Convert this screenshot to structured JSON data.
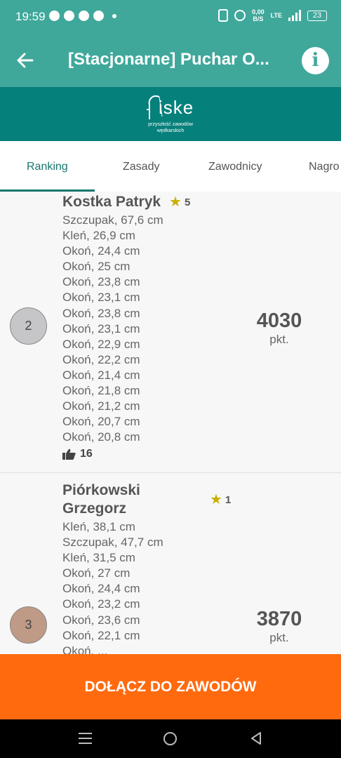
{
  "status_bar": {
    "time": "19:59",
    "net_speed_value": "0,00",
    "net_speed_unit": "B/S",
    "network_type": "LTE",
    "battery": "23",
    "left_icons": [
      "whatsapp-icon",
      "facebook-icon",
      "chrome-icon",
      "messenger-icon",
      "dot-icon"
    ],
    "right_icons": [
      "vibrate-icon",
      "alarm-icon",
      "signal-icon",
      "battery-icon"
    ]
  },
  "app_bar": {
    "title": "[Stacjonarne] Puchar O...",
    "back_icon": "arrow-left-icon",
    "info_label": "i",
    "color": "#3fa89b"
  },
  "brand": {
    "name": "iske",
    "tagline_line1": "przyszłość zawodów",
    "tagline_line2": "wędkarskich",
    "color": "#06807b"
  },
  "tabs": [
    {
      "label": "Ranking",
      "active": true
    },
    {
      "label": "Zasady",
      "active": false
    },
    {
      "label": "Zawodnicy",
      "active": false
    },
    {
      "label": "Nagro",
      "active": false
    }
  ],
  "ranking": [
    {
      "rank": "2",
      "name_line1": "Kostka Patryk",
      "name_line2": "",
      "stars": "5",
      "catches": [
        "Szczupak, 67,6 cm",
        "Kleń, 26,9 cm",
        "Okoń, 24,4 cm",
        "Okoń, 25 cm",
        "Okoń, 23,8 cm",
        "Okoń, 23,1 cm",
        "Okoń, 23,8 cm",
        "Okoń, 23,1 cm",
        "Okoń, 22,9 cm",
        "Okoń, 22,2 cm",
        "Okoń, 21,4 cm",
        "Okoń, 21,8 cm",
        "Okoń, 21,2 cm",
        "Okoń, 20,7 cm",
        "Okoń, 20,8 cm"
      ],
      "likes": "16",
      "points": "4030",
      "points_unit": "pkt.",
      "badge_color": "#c6c6c9"
    },
    {
      "rank": "3",
      "name_line1": "Piórkowski",
      "name_line2": "Grzegorz",
      "stars": "1",
      "catches": [
        "Kleń, 38,1 cm",
        "Szczupak, 47,7 cm",
        "Kleń, 31,5 cm",
        "Okoń, 27 cm",
        "Okoń, 24,4 cm",
        "Okoń, 23,2 cm",
        "Okoń, 23,6 cm",
        "Okoń, 22,1 cm",
        "Okoń, ..."
      ],
      "points": "3870",
      "points_unit": "pkt.",
      "badge_color": "#bf9a86"
    }
  ],
  "join_button": {
    "label": "DOŁĄCZ DO ZAWODÓW",
    "color": "#ff6a0f"
  },
  "nav_bar": {
    "icons": [
      "recent-apps-icon",
      "home-icon",
      "back-icon"
    ]
  }
}
